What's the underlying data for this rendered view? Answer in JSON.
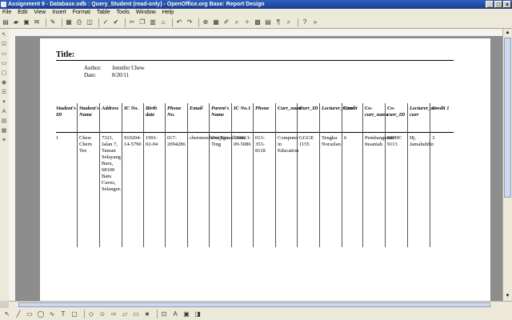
{
  "window": {
    "title": "Assignment 9 - Database.odb : Query_Student (read-only) - OpenOffice.org Base: Report Design",
    "buttons": [
      "_",
      "□",
      "×"
    ]
  },
  "menu": [
    "File",
    "Edit",
    "View",
    "Insert",
    "Format",
    "Table",
    "Tools",
    "Window",
    "Help"
  ],
  "report": {
    "title_label": "Title:",
    "author_label": "Author:",
    "author": "Jennifer Chew",
    "date_label": "Date:",
    "date": "8/20/11",
    "columns": [
      "Student's ID",
      "Student's Name",
      "Address",
      "IC No.",
      "Birth date",
      "Phone No.",
      "Email",
      "Parent's Name",
      "IC No.1",
      "Phone",
      "Curr_name",
      "Curr_ID",
      "Lecturer_Curr",
      "Credit",
      "Co-curr_name",
      "Co-curr_ID",
      "Lecturer_co-curr",
      "Credit 1"
    ],
    "row": [
      "1",
      "Chew Chern Tee",
      "7321, Jalan 7, Taman Selayang Baru, 68100 Batu Caves, Selangor.",
      "910204-14-5790",
      "1991-02-04",
      "017-2094286",
      "chernteechew@gmail.com",
      "Ooi Kim Ting",
      "580613-09-5086",
      "013-353-8118",
      "Computer in Education",
      "GGGE 1155",
      "Tengku Norazlan",
      "6",
      "Pembangunan Insaniah",
      "HHHC 9113",
      "Hj. Jamaluddin",
      "3"
    ]
  }
}
